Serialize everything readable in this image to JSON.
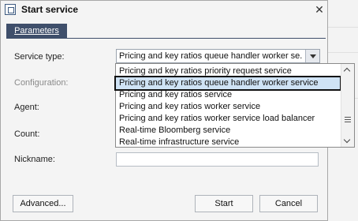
{
  "window": {
    "title": "Start service",
    "close_glyph": "✕"
  },
  "tabs": [
    {
      "label": "Parameters"
    }
  ],
  "form": {
    "service_type_label": "Service type:",
    "configuration_label": "Configuration:",
    "agent_label": "Agent:",
    "count_label": "Count:",
    "nickname_label": "Nickname:",
    "service_type_value": "Pricing and key ratios queue handler worker se...",
    "nickname_value": ""
  },
  "dropdown": {
    "items": [
      "Pricing and key ratios priority request service",
      "Pricing and key ratios queue handler worker service",
      "Pricing and key ratios service",
      "Pricing and key ratios worker service",
      "Pricing and key ratios worker service load balancer",
      "Real-time Bloomberg service",
      "Real-time infrastructure service"
    ],
    "selected_index": 1
  },
  "buttons": {
    "advanced": "Advanced...",
    "start": "Start",
    "cancel": "Cancel"
  },
  "colors": {
    "tab_active": "#3f4f6b",
    "selection_highlight": "#cfe3f5"
  }
}
